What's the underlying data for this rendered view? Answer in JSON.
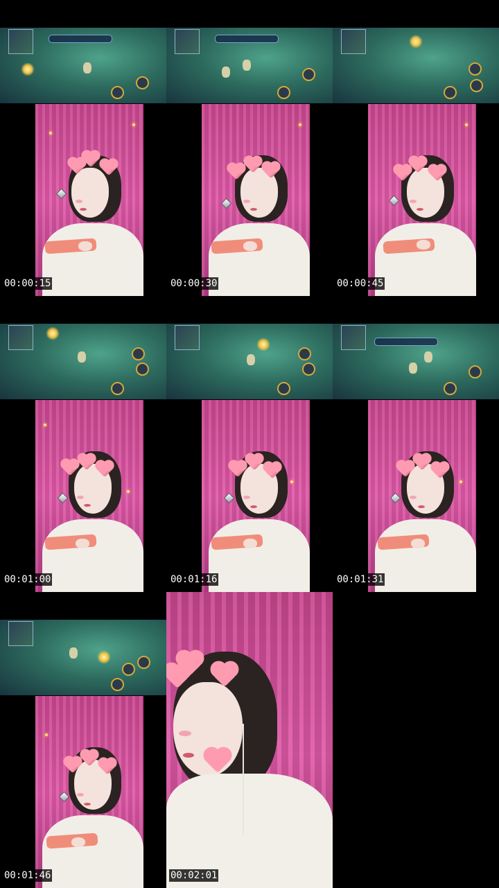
{
  "frames": [
    {
      "timestamp": "00:00:15"
    },
    {
      "timestamp": "00:00:30"
    },
    {
      "timestamp": "00:00:45"
    },
    {
      "timestamp": "00:01:00"
    },
    {
      "timestamp": "00:01:16"
    },
    {
      "timestamp": "00:01:31"
    },
    {
      "timestamp": "00:01:46"
    },
    {
      "timestamp": "00:02:01"
    }
  ],
  "colors": {
    "background": "#000000",
    "curtain_pink": "#e05aa8",
    "game_green": "#2d6b5e",
    "heart_pink": "#ff9bb1",
    "timestamp_bg": "#000000",
    "timestamp_text": "#ffffff"
  },
  "icons": [
    "minimap-icon",
    "skill-button-icon",
    "heart-sticker-icon",
    "sparkle-icon"
  ]
}
